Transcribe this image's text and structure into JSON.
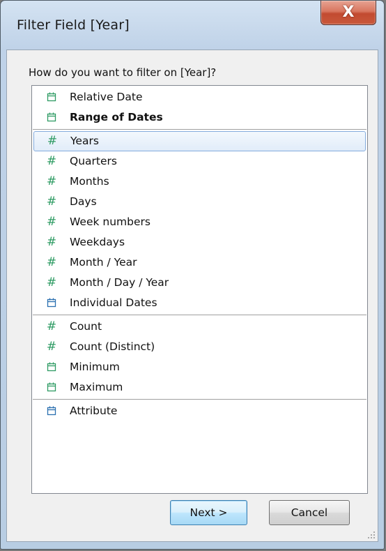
{
  "window": {
    "title": "Filter Field [Year]",
    "close_glyph": "X"
  },
  "prompt": "How do you want to filter on [Year]?",
  "list": {
    "groups": [
      [
        {
          "label": "Relative Date",
          "icon": "calendar-icon",
          "color": "#2e9b63"
        },
        {
          "label": "Range of Dates",
          "icon": "calendar-icon",
          "color": "#2e9b63",
          "bold": true
        }
      ],
      [
        {
          "label": "Years",
          "icon": "hash-icon",
          "color": "#2e9b63",
          "selected": true
        },
        {
          "label": "Quarters",
          "icon": "hash-icon",
          "color": "#2e9b63"
        },
        {
          "label": "Months",
          "icon": "hash-icon",
          "color": "#2e9b63"
        },
        {
          "label": "Days",
          "icon": "hash-icon",
          "color": "#2e9b63"
        },
        {
          "label": "Week numbers",
          "icon": "hash-icon",
          "color": "#2e9b63"
        },
        {
          "label": "Weekdays",
          "icon": "hash-icon",
          "color": "#2e9b63"
        },
        {
          "label": "Month / Year",
          "icon": "hash-icon",
          "color": "#2e9b63"
        },
        {
          "label": "Month / Day / Year",
          "icon": "hash-icon",
          "color": "#2e9b63"
        },
        {
          "label": "Individual Dates",
          "icon": "calendar-icon",
          "color": "#2a6fb0"
        }
      ],
      [
        {
          "label": "Count",
          "icon": "hash-icon",
          "color": "#2e9b63"
        },
        {
          "label": "Count (Distinct)",
          "icon": "hash-icon",
          "color": "#2e9b63"
        },
        {
          "label": "Minimum",
          "icon": "calendar-icon",
          "color": "#2e9b63"
        },
        {
          "label": "Maximum",
          "icon": "calendar-icon",
          "color": "#2e9b63"
        }
      ],
      [
        {
          "label": "Attribute",
          "icon": "calendar-icon",
          "color": "#2a6fb0"
        }
      ]
    ]
  },
  "buttons": {
    "next": "Next >",
    "cancel": "Cancel"
  }
}
